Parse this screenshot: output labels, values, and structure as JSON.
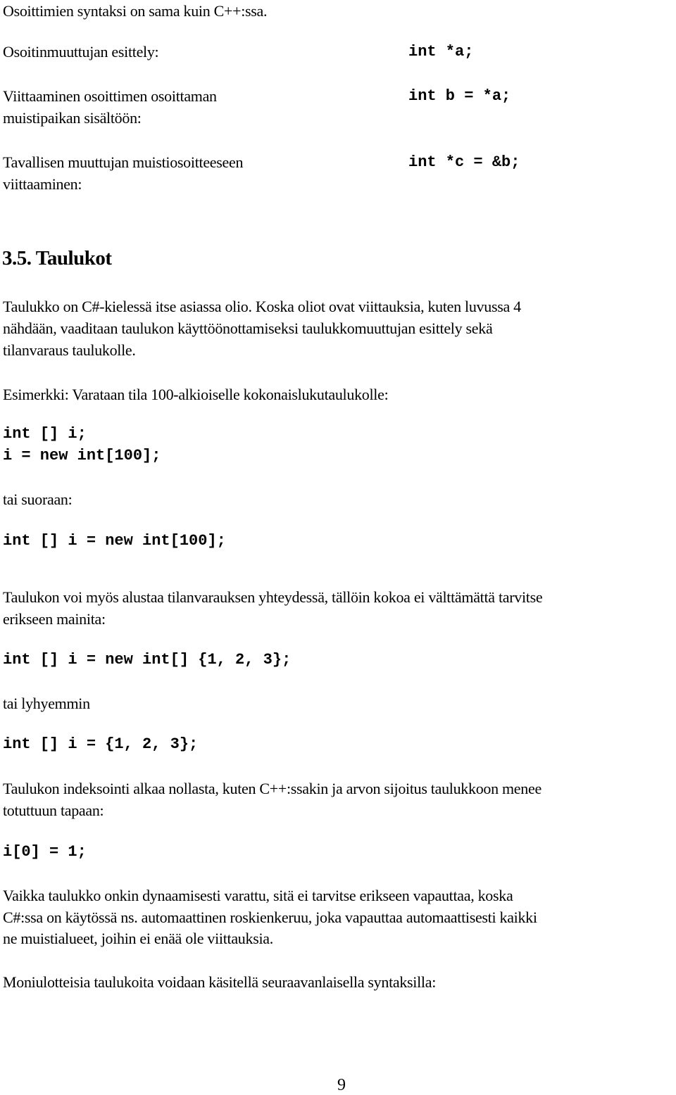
{
  "intro": {
    "text": "Osoittimien syntaksi on sama kuin C++:ssa."
  },
  "pointer_table": [
    {
      "label_lines": [
        "Osoitinmuuttujan esittely:"
      ],
      "code": "int *a;"
    },
    {
      "label_lines": [
        "Viittaaminen osoittimen osoittaman",
        "muistipaikan sisältöön:"
      ],
      "code": "int b = *a;"
    },
    {
      "label_lines": [
        "Tavallisen muuttujan muistiosoitteeseen",
        "viittaaminen:"
      ],
      "code": "int *c = &b;"
    }
  ],
  "section": {
    "heading": "3.5. Taulukot",
    "paragraph1": [
      "Taulukko on C#-kielessä itse asiassa olio. Koska oliot ovat viittauksia, kuten luvussa 4",
      "nähdään, vaaditaan taulukon käyttöönottamiseksi taulukkomuuttujan esittely sekä",
      "tilanvaraus taulukolle."
    ],
    "example_intro": "Esimerkki: Varataan tila 100-alkioiselle kokonaislukutaulukolle:",
    "code1": [
      "int [] i;",
      "i = new int[100];"
    ],
    "or_direct": "tai suoraan:",
    "code2": "int [] i = new int[100];",
    "paragraph2": [
      "Taulukon voi myös alustaa tilanvarauksen yhteydessä, tällöin kokoa ei välttämättä tarvitse",
      "erikseen mainita:"
    ],
    "code3": "int [] i = new int[] {1, 2, 3};",
    "or_shorter": "tai lyhyemmin",
    "code4": "int [] i = {1, 2, 3};",
    "paragraph3": [
      "Taulukon indeksointi alkaa nollasta, kuten C++:ssakin ja arvon sijoitus taulukkoon menee",
      "totuttuun tapaan:"
    ],
    "code5": "i[0] = 1;",
    "paragraph4": [
      "Vaikka taulukko onkin dynaamisesti varattu, sitä ei tarvitse erikseen vapauttaa, koska",
      "C#:ssa on käytössä ns. automaattinen roskienkeruu, joka vapauttaa automaattisesti kaikki",
      "ne muistialueet, joihin ei enää ole viittauksia."
    ],
    "paragraph5": "Moniulotteisia taulukoita voidaan käsitellä seuraavanlaisella syntaksilla:"
  },
  "footer": {
    "page_number": "9"
  }
}
